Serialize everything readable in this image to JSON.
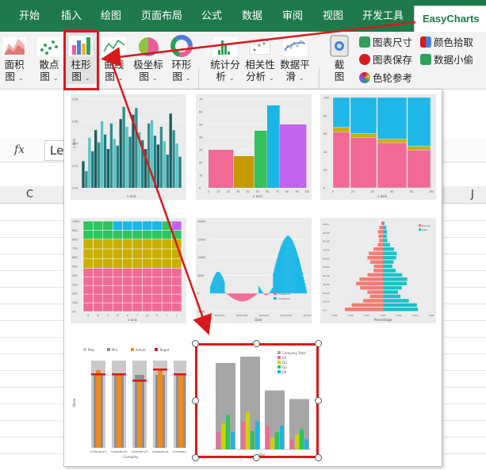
{
  "ribbon_tabs": [
    "开始",
    "插入",
    "绘图",
    "页面布局",
    "公式",
    "数据",
    "审阅",
    "视图",
    "开发工具"
  ],
  "active_tab": "EasyCharts",
  "ribbon_buttons": {
    "area": {
      "line1": "面积",
      "line2": "图"
    },
    "scatter": {
      "line1": "散点",
      "line2": "图"
    },
    "bar": {
      "line1": "柱形",
      "line2": "图"
    },
    "curve": {
      "line1": "曲线",
      "line2": "图"
    },
    "polar": {
      "line1": "极坐标",
      "line2": "图"
    },
    "ring": {
      "line1": "环形",
      "line2": "图"
    },
    "stats": {
      "line1": "统计分",
      "line2": "析"
    },
    "correlation": {
      "line1": "相关性",
      "line2": "分析"
    },
    "smoothing": {
      "line1": "数据平",
      "line2": "滑"
    },
    "screenshot": {
      "line1": "截",
      "line2": "图"
    }
  },
  "side_tools": {
    "chart_size": "图表尺寸",
    "chart_save": "图表保存",
    "color_wheel": "色轮参考",
    "color_pick": "颜色拾取",
    "data_thief": "数据小偷"
  },
  "formula_bar": {
    "fx": "fx",
    "content": "Le"
  },
  "columns": {
    "c": "C",
    "j": "J"
  },
  "colors": {
    "ribbon_green": "#1f7a4b",
    "highlight_red": "#d9191c"
  },
  "chart_data": [
    {
      "type": "bar",
      "title": "",
      "xlabel": "x axis",
      "ylabel": "y axis",
      "ylim": [
        0,
        0.08
      ],
      "values": [
        0.024,
        0.015,
        0.045,
        0.033,
        0.052,
        0.041,
        0.06,
        0.048,
        0.035,
        0.058,
        0.044,
        0.038,
        0.062,
        0.073,
        0.055,
        0.046,
        0.066,
        0.072,
        0.05,
        0.043,
        0.035,
        0.058,
        0.061,
        0.047,
        0.039,
        0.055,
        0.042,
        0.03,
        0.067,
        0.052,
        0.04,
        0.028
      ]
    },
    {
      "type": "bar",
      "title": "",
      "xlabel": "x axis",
      "ylabel": "y axis",
      "ylim": [
        0,
        70
      ],
      "series": [
        {
          "values": [
            30,
            25,
            45,
            65,
            50
          ]
        }
      ]
    },
    {
      "type": "bar",
      "title": "",
      "xlabel": "x axis",
      "ylabel": "y axis",
      "ylim": [
        0,
        100
      ]
    },
    {
      "type": "bar",
      "title": "",
      "xlabel": "x axis",
      "ylabel": "y axis",
      "ylim": [
        0,
        100
      ],
      "categories": [
        "a",
        "b",
        "c",
        "d",
        "e",
        "f",
        "g",
        "h",
        "i",
        "j"
      ]
    },
    {
      "type": "area",
      "title": "",
      "xlabel": "Date",
      "ylabel": "Value",
      "ylim": [
        -5000,
        20000
      ],
      "x": [
        "1970/3/1",
        "1970/10/1",
        "1971/5/1",
        "1971/12/1",
        "1972/7/1"
      ],
      "series": [
        {
          "name": "Threshold"
        },
        {
          "name": "Threshold"
        }
      ]
    },
    {
      "type": "bar",
      "title": "",
      "xlabel": "Percentage",
      "ylabel": "Age",
      "series": [
        {
          "name": "Female"
        },
        {
          "name": "Male"
        }
      ],
      "x": [
        "0.06",
        "0.04",
        "0.02",
        "0.00",
        "0.02",
        "0.04",
        "0.06"
      ],
      "categories": [
        "0-4",
        "5-9",
        "10-14",
        "15-19",
        "20-24",
        "25-29",
        "30-34",
        "35-39",
        "40-44",
        "45-49",
        "50-54",
        "55-59",
        "60-64",
        "65-69",
        "70-74",
        "75-79",
        "80-84",
        "85-89",
        "90-94",
        "95-99",
        "100+"
      ]
    },
    {
      "type": "bar",
      "title": "",
      "xlabel": "Company",
      "ylabel": "Value",
      "categories": [
        "Company1",
        "Company2",
        "Company3",
        "Company4",
        "Company5"
      ],
      "series": [
        {
          "name": "Max"
        },
        {
          "name": "Min"
        },
        {
          "name": "Actual"
        },
        {
          "name": "Target"
        }
      ]
    },
    {
      "type": "bar",
      "title": "",
      "xlabel": "Year",
      "ylabel": "",
      "series": [
        {
          "name": "Company Total"
        },
        {
          "name": "Q1"
        },
        {
          "name": "Q2"
        },
        {
          "name": "Q3"
        },
        {
          "name": "Q4"
        }
      ]
    }
  ]
}
